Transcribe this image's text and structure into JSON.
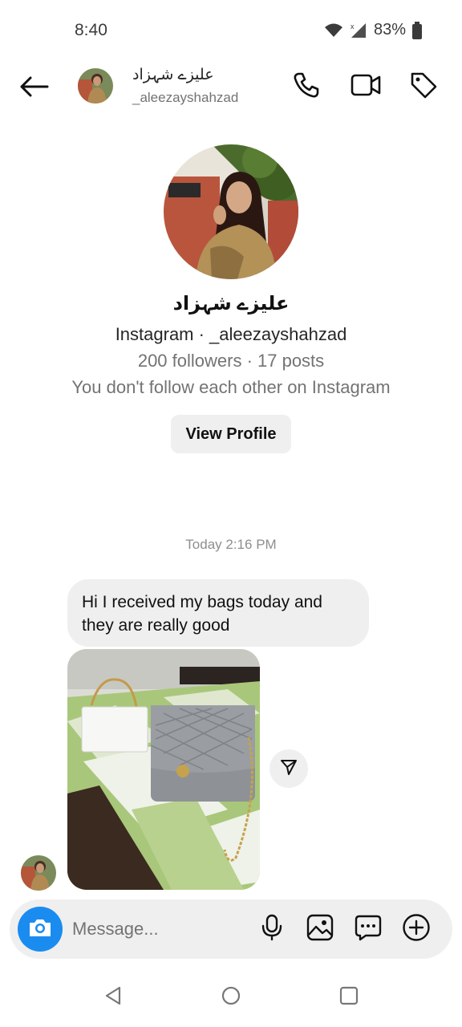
{
  "status_bar": {
    "time": "8:40",
    "battery": "83%",
    "icons": [
      "wifi-icon",
      "signal-icon",
      "battery-icon"
    ]
  },
  "header": {
    "name": "علیزے شہزاد",
    "username": "_aleezayshahzad",
    "icons": [
      "back-arrow-icon",
      "phone-icon",
      "video-camera-icon",
      "tag-icon"
    ]
  },
  "profile": {
    "name": "علیزے شہزاد",
    "subtitle": "Instagram · _aleezayshahzad",
    "stats": "200 followers · 17 posts",
    "follow_status": "You don't follow each other on Instagram",
    "view_profile_label": "View Profile"
  },
  "chat": {
    "timestamp": "Today 2:16 PM",
    "messages": [
      {
        "text": "Hi I received my bags today and they are really good"
      }
    ]
  },
  "composer": {
    "placeholder": "Message...",
    "icons": [
      "camera-icon",
      "microphone-icon",
      "gallery-icon",
      "sticker-icon",
      "add-icon"
    ]
  },
  "nav": {
    "icons": [
      "nav-back-icon",
      "nav-home-icon",
      "nav-recents-icon"
    ]
  },
  "colors": {
    "accent_blue": "#1a8cf0",
    "bubble_gray": "#efefef",
    "muted_text": "#737373"
  }
}
